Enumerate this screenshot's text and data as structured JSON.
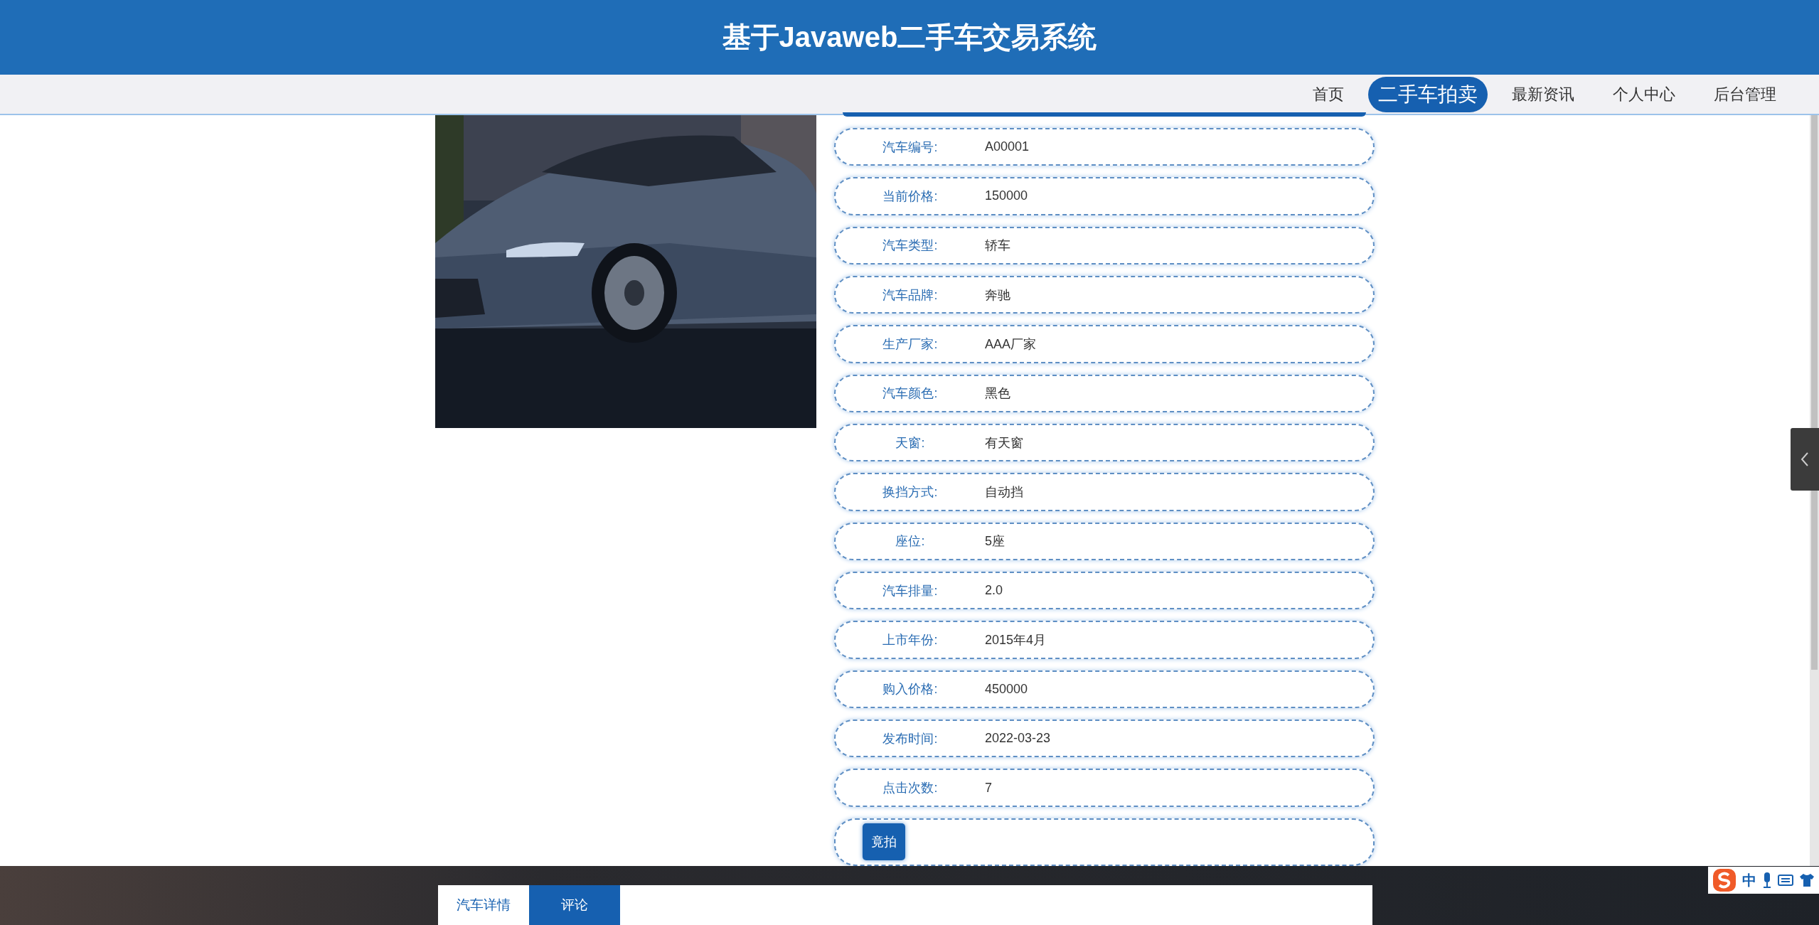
{
  "header": {
    "title": "基于Javaweb二手车交易系统"
  },
  "nav": [
    {
      "label": "首页",
      "selected": false
    },
    {
      "label": "二手车拍卖",
      "selected": true
    },
    {
      "label": "最新资讯",
      "selected": false
    },
    {
      "label": "个人中心",
      "selected": false
    },
    {
      "label": "后台管理",
      "selected": false
    }
  ],
  "details": [
    {
      "label": "汽车编号:",
      "value": "A00001"
    },
    {
      "label": "当前价格:",
      "value": "150000"
    },
    {
      "label": "汽车类型:",
      "value": "轿车"
    },
    {
      "label": "汽车品牌:",
      "value": "奔驰"
    },
    {
      "label": "生产厂家:",
      "value": "AAA厂家"
    },
    {
      "label": "汽车颜色:",
      "value": "黑色"
    },
    {
      "label": "天窗:",
      "value": "有天窗"
    },
    {
      "label": "换挡方式:",
      "value": "自动挡"
    },
    {
      "label": "座位:",
      "value": "5座"
    },
    {
      "label": "汽车排量:",
      "value": "2.0"
    },
    {
      "label": "上市年份:",
      "value": "2015年4月"
    },
    {
      "label": "购入价格:",
      "value": "450000"
    },
    {
      "label": "发布时间:",
      "value": "2022-03-23"
    },
    {
      "label": "点击次数:",
      "value": "7"
    }
  ],
  "bid_button": "竟拍",
  "tabs": [
    {
      "label": "汽车详情",
      "selected": false
    },
    {
      "label": "评论",
      "selected": true
    }
  ],
  "ime_toolbar": {
    "mode": "中"
  }
}
